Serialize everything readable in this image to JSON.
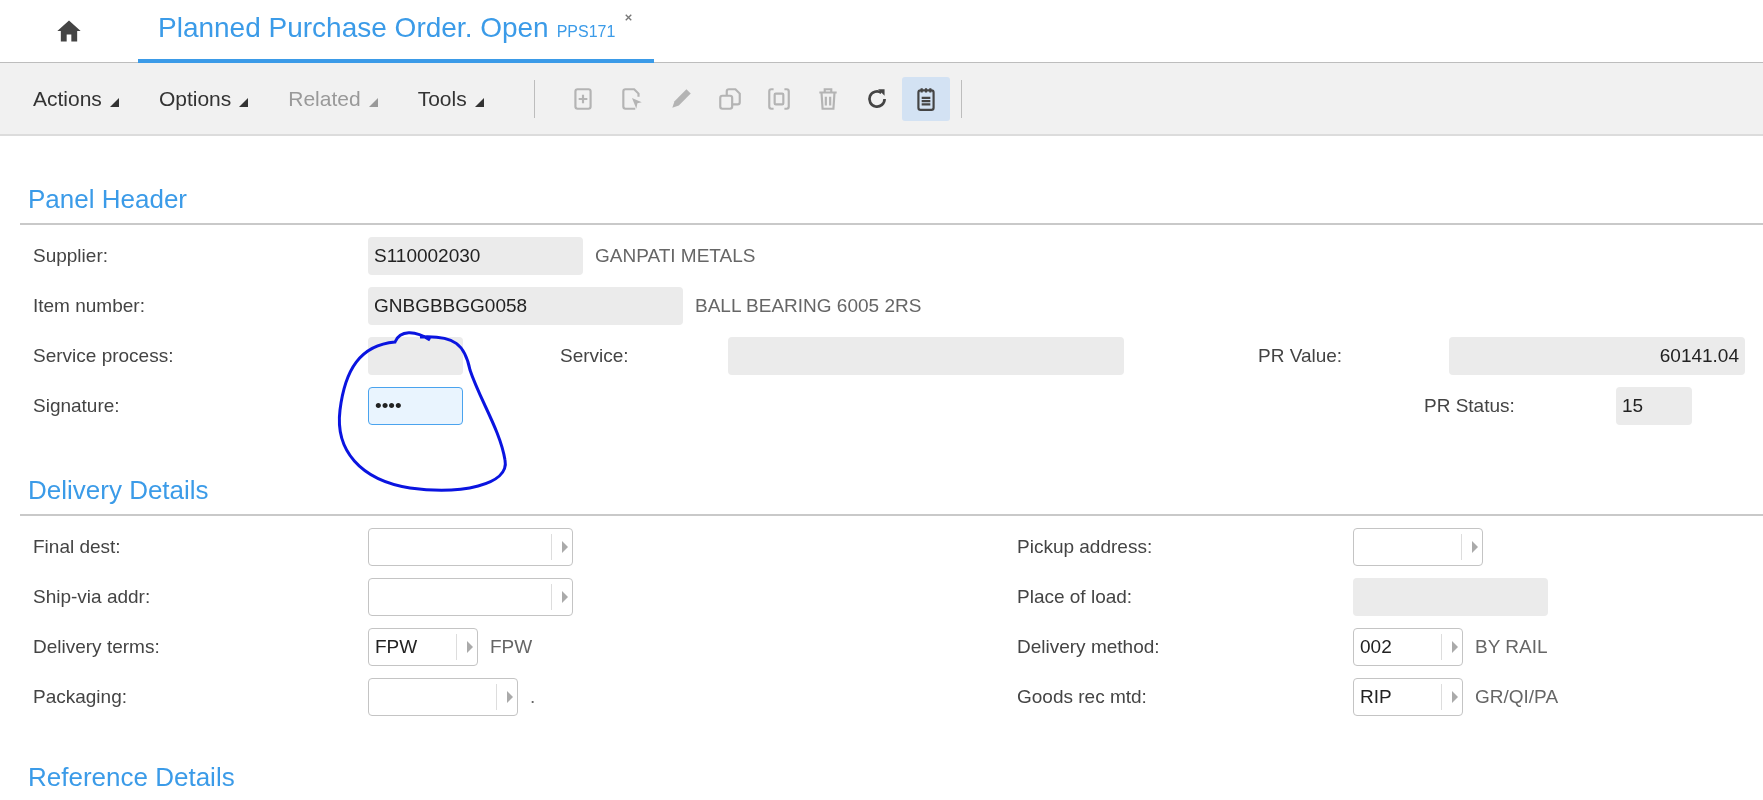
{
  "tabs": [
    {
      "label": "Planned Purchase Order. Open",
      "code": "PPS171",
      "selected": true,
      "closable": true
    }
  ],
  "toolbar": {
    "menus": [
      {
        "label": "Actions",
        "disabled": false
      },
      {
        "label": "Options",
        "disabled": false
      },
      {
        "label": "Related",
        "disabled": true
      },
      {
        "label": "Tools",
        "disabled": false
      }
    ],
    "tools": [
      {
        "kind": "new",
        "disabled": true,
        "selected": false
      },
      {
        "kind": "select",
        "disabled": true,
        "selected": false
      },
      {
        "kind": "edit",
        "disabled": true,
        "selected": false
      },
      {
        "kind": "copy",
        "disabled": true,
        "selected": false
      },
      {
        "kind": "duplicate",
        "disabled": true,
        "selected": false
      },
      {
        "kind": "delete",
        "disabled": true,
        "selected": false
      },
      {
        "kind": "refresh",
        "disabled": false,
        "selected": false
      },
      {
        "kind": "notes",
        "disabled": false,
        "selected": true
      }
    ]
  },
  "sections": [
    {
      "title": "Panel Header",
      "rows": [
        [
          {
            "label": "Supplier:",
            "field": {
              "kind": "readonly",
              "value": "S110002030"
            },
            "description": "GANPATI METALS"
          },
          "",
          ""
        ],
        [
          {
            "label": "Item number:",
            "field": {
              "kind": "readonly",
              "value": "GNBGBBGG0058"
            },
            "description": "BALL BEARING 6005 2RS"
          },
          "",
          ""
        ],
        [
          {
            "label": "Service process:",
            "field": {
              "kind": "readonly"
            }
          },
          {
            "label": "Service:",
            "field": {
              "kind": "readonly"
            }
          },
          {
            "label": "PR Value:",
            "field": {
              "kind": "readonly-number",
              "value": "60141.04"
            }
          }
        ],
        [
          {
            "label": "Signature:",
            "field": {
              "kind": "input",
              "value": "••••",
              "focused": true
            }
          },
          "",
          {
            "label": "PR Status:",
            "field": {
              "kind": "readonly",
              "value": "15"
            }
          }
        ]
      ]
    },
    {
      "title": "Delivery Details",
      "rows": [
        [
          {
            "label": "Final dest:",
            "field": {
              "kind": "lookup"
            }
          },
          {
            "label": "Pickup address:",
            "field": {
              "kind": "lookup"
            }
          }
        ],
        [
          {
            "label": "Ship-via addr:",
            "field": {
              "kind": "lookup"
            }
          },
          {
            "label": "Place of load:",
            "field": {
              "kind": "readonly"
            }
          }
        ],
        [
          {
            "label": "Delivery terms:",
            "field": {
              "kind": "lookup",
              "value": "FPW"
            },
            "description": "FPW"
          },
          {
            "label": "Delivery method:",
            "field": {
              "kind": "lookup",
              "value": "002"
            },
            "description": "BY RAIL"
          }
        ],
        [
          {
            "label": "Packaging:",
            "field": {
              "kind": "lookup"
            },
            "description": "."
          },
          {
            "label": "Goods rec mtd:",
            "field": {
              "kind": "lookup",
              "value": "RIP"
            },
            "description": "GR/QI/PA"
          }
        ]
      ]
    },
    {
      "title": "Reference Details"
    }
  ],
  "annotations": [
    {
      "kind": "freehand-circle"
    }
  ]
}
